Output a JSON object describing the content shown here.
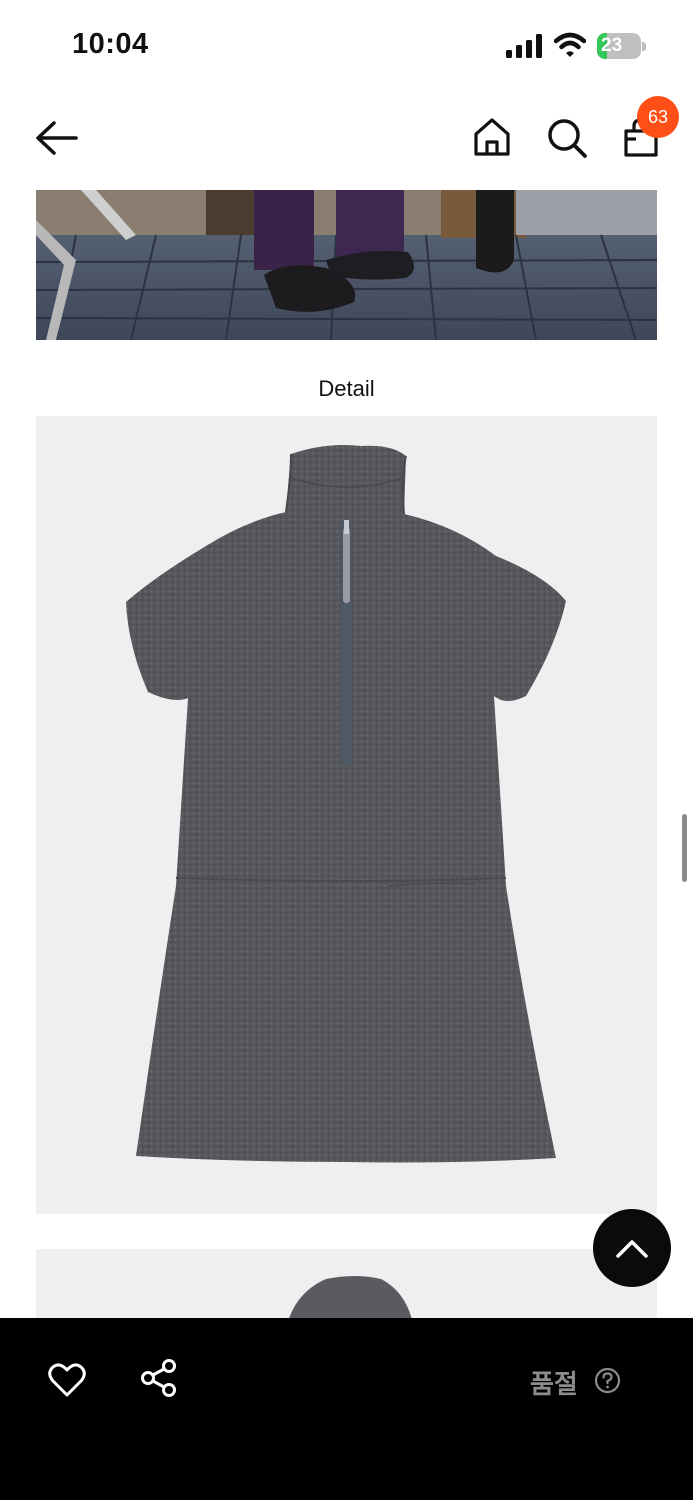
{
  "status_bar": {
    "time": "10:04",
    "battery_level": "23",
    "battery_percent": 0.23
  },
  "nav": {
    "cart_count": "63",
    "icons": [
      "back-arrow-icon",
      "home-icon",
      "search-icon",
      "shopping-bag-icon"
    ]
  },
  "content": {
    "section_title": "Detail"
  },
  "bottom_bar": {
    "status_label": "품절",
    "icons": [
      "heart-icon",
      "share-icon",
      "help-circle-icon"
    ]
  },
  "colors": {
    "badge": "#ff4f17",
    "bottom_bar": "#000000",
    "status_label": "#8c8c8c",
    "image_background": "#efefef",
    "battery_fill": "#34c759"
  }
}
